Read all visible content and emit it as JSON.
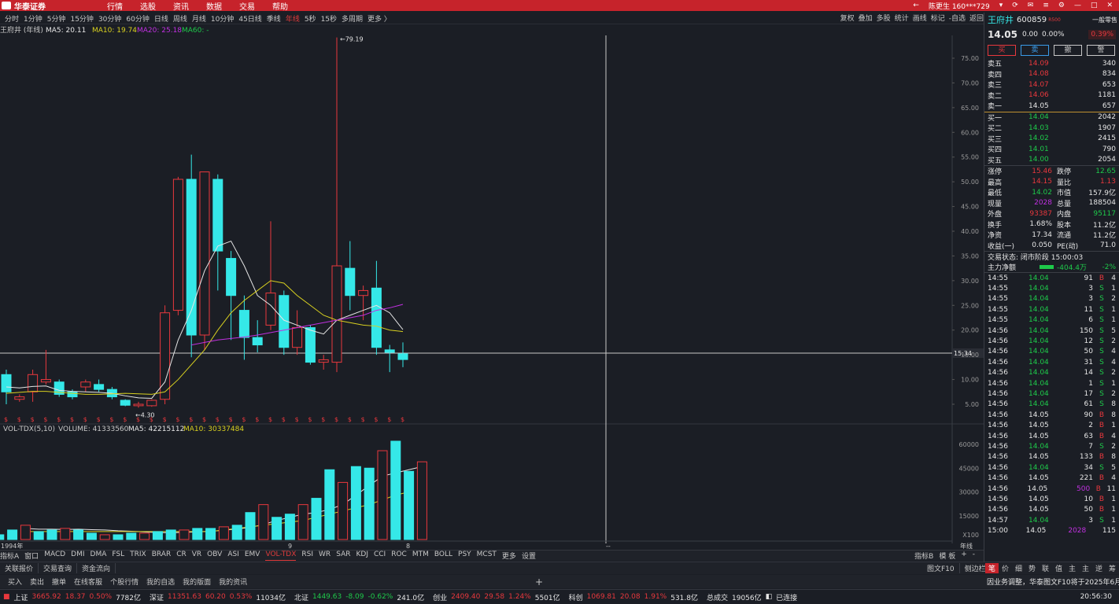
{
  "app": {
    "logo": "华泰证券",
    "menu": [
      "行情",
      "选股",
      "资讯",
      "数据",
      "交易",
      "帮助"
    ],
    "user": "陈更生 160***729"
  },
  "periods": [
    "分时",
    "1分钟",
    "5分钟",
    "15分钟",
    "30分钟",
    "60分钟",
    "日线",
    "周线",
    "月线",
    "10分钟",
    "45日线",
    "季线",
    "年线",
    "5秒",
    "15秒",
    "多周期",
    "更多 〉"
  ],
  "active_period": "年线",
  "tools": [
    "复权",
    "叠加",
    "多股",
    "统计",
    "画线",
    "标记",
    "-自选",
    "返回"
  ],
  "legend": {
    "name": "王府井 (年线)",
    "ma5": "MA5: 20.11",
    "ma10": "MA10: 19.74",
    "ma20": "MA20: 25.18",
    "ma60": "MA60: -"
  },
  "vol_legend": {
    "title": "VOL-TDX(5,10)",
    "volume": "VOLUME: 41333560",
    "ma5": "MA5: 42215112",
    "ma10": "MA10: 30337484"
  },
  "price_axis": [
    "75.00",
    "70.00",
    "65.00",
    "60.00",
    "55.00",
    "50.00",
    "45.00",
    "40.00",
    "35.00",
    "30.00",
    "25.00",
    "20.00",
    "15.00",
    "10.00",
    "5.00"
  ],
  "vol_axis": [
    "60000",
    "45000",
    "30000",
    "15000"
  ],
  "vol_unit": "X100",
  "crosshair_price": "15.34",
  "max_label": "79.19",
  "min_label": "4.30",
  "x_labels": {
    "start": "1994年",
    "mid": "9",
    "end": "8",
    "right": "年线",
    "dash": "--"
  },
  "colors": {
    "up": "#e8383d",
    "down": "#35e8e8",
    "ma5": "#e6e6e6",
    "ma10": "#d8d020",
    "ma20": "#c030e0"
  },
  "candles": [
    {
      "o": 11,
      "c": 7.5,
      "h": 12,
      "l": 5
    },
    {
      "o": 6,
      "c": 6.5,
      "h": 7,
      "l": 5.5
    },
    {
      "o": 7.5,
      "c": 11,
      "h": 12,
      "l": 5.5
    },
    {
      "o": 9.5,
      "c": 10,
      "h": 16,
      "l": 9
    },
    {
      "o": 9.5,
      "c": 7,
      "h": 10,
      "l": 6.5
    },
    {
      "o": 7.5,
      "c": 6.5,
      "h": 8,
      "l": 6
    },
    {
      "o": 8.5,
      "c": 9.5,
      "h": 10,
      "l": 7.5
    },
    {
      "o": 9,
      "c": 8,
      "h": 10,
      "l": 7.5
    },
    {
      "o": 8,
      "c": 6.5,
      "h": 8.5,
      "l": 6
    },
    {
      "o": 5.8,
      "c": 4.8,
      "h": 6,
      "l": 4.6
    },
    {
      "o": 4.7,
      "c": 5,
      "h": 5.5,
      "l": 4.3
    },
    {
      "o": 4.7,
      "c": 5.8,
      "h": 6,
      "l": 4.5
    },
    {
      "o": 6,
      "c": 23.5,
      "h": 25,
      "l": 5
    },
    {
      "o": 24,
      "c": 50.5,
      "h": 51,
      "l": 23
    },
    {
      "o": 50.5,
      "c": 19,
      "h": 55.5,
      "l": 14.5
    },
    {
      "o": 19,
      "c": 52,
      "h": 52,
      "l": 16
    },
    {
      "o": 50.5,
      "c": 36,
      "h": 51.5,
      "l": 28
    },
    {
      "o": 34.5,
      "c": 27,
      "h": 36,
      "l": 18
    },
    {
      "o": 24,
      "c": 18.5,
      "h": 27,
      "l": 14
    },
    {
      "o": 18.5,
      "c": 17,
      "h": 22,
      "l": 15.5
    },
    {
      "o": 21,
      "c": 27.5,
      "h": 42,
      "l": 20
    },
    {
      "o": 27,
      "c": 16.5,
      "h": 28,
      "l": 15
    },
    {
      "o": 16.5,
      "c": 20.5,
      "h": 24,
      "l": 15
    },
    {
      "o": 20.5,
      "c": 13.5,
      "h": 21,
      "l": 13
    },
    {
      "o": 13.5,
      "c": 14,
      "h": 15,
      "l": 12
    },
    {
      "o": 13.5,
      "c": 33,
      "h": 79.19,
      "l": 11.5
    },
    {
      "o": 32.5,
      "c": 27,
      "h": 38,
      "l": 24
    },
    {
      "o": 27,
      "c": 28,
      "h": 29,
      "l": 22
    },
    {
      "o": 28.5,
      "c": 16.5,
      "h": 34,
      "l": 15
    },
    {
      "o": 16,
      "c": 15.5,
      "h": 17,
      "l": 11.5
    },
    {
      "o": 15.2,
      "c": 14.05,
      "h": 17.5,
      "l": 12.5
    }
  ],
  "ma5_line": [
    8.5,
    8.3,
    8.6,
    8.7,
    7.8,
    7.6,
    7.5,
    7.4,
    7.2,
    6.7,
    6.3,
    6.2,
    9.5,
    18,
    24,
    32,
    37,
    38,
    33,
    27,
    25,
    22,
    21,
    20,
    19.2,
    22,
    23,
    24,
    25,
    23.5,
    20.1
  ],
  "ma10_line": [
    7.2,
    7.4,
    7.6,
    7.6,
    7.4,
    7.2,
    7,
    7,
    7.1,
    7.2,
    7.1,
    7,
    7.5,
    10,
    13,
    16,
    20,
    23.5,
    26,
    28,
    30,
    29.5,
    27,
    25,
    23,
    22,
    21.5,
    21,
    20.8,
    20,
    19.7
  ],
  "ma20_line": [
    17,
    17.5,
    18,
    18.3,
    18.6,
    19,
    19.5,
    20,
    20.5,
    21,
    21.5,
    22,
    22.5,
    23,
    24,
    24.5,
    25.2
  ],
  "volumes": [
    8,
    3,
    6,
    9,
    5,
    6,
    7,
    6,
    4,
    3,
    3,
    4,
    4,
    5,
    6,
    6,
    7,
    7,
    8,
    9,
    17,
    22,
    14,
    16,
    22,
    26,
    44,
    36,
    46,
    45,
    56,
    62,
    43,
    49
  ],
  "vol_ma5": [
    7,
    6.5,
    6.5,
    6.3,
    6.5,
    6.2,
    6,
    5.5,
    5.2,
    4.8,
    4.4,
    4.3,
    4.5,
    4.8,
    5.2,
    5.8,
    6.6,
    7.6,
    9.5,
    12,
    14,
    16,
    17,
    19,
    22,
    28,
    34,
    40,
    42,
    44,
    46
  ],
  "vol_ma10": [
    5,
    5,
    5,
    5,
    5,
    5,
    5,
    5,
    5,
    5,
    5,
    5,
    5,
    5,
    5,
    6,
    7,
    8,
    9,
    10,
    11,
    12,
    14,
    16,
    18,
    20,
    22,
    25,
    28,
    30
  ],
  "dividend_marks": [
    "$",
    "$",
    "$",
    "$",
    "$",
    "$",
    "$",
    "$",
    "$",
    "$",
    "$",
    "$",
    "$",
    "$",
    "$",
    "$",
    "$",
    "$",
    "$",
    "$",
    "$",
    "$",
    "$",
    "$",
    "$",
    "$",
    "$",
    "$",
    "$",
    "$",
    "$"
  ],
  "quote": {
    "name": "王府井",
    "code": "600859",
    "tag": "R500",
    "mode": "一般零售",
    "price": "14.05",
    "change": "0.00",
    "pct": "0.00%",
    "sector_pct": "0.39%",
    "buttons": [
      "买",
      "卖",
      "撤",
      "警"
    ],
    "asks": [
      {
        "l": "卖五",
        "p": "14.09",
        "v": "340"
      },
      {
        "l": "卖四",
        "p": "14.08",
        "v": "834"
      },
      {
        "l": "卖三",
        "p": "14.07",
        "v": "653"
      },
      {
        "l": "卖二",
        "p": "14.06",
        "v": "1181"
      },
      {
        "l": "卖一",
        "p": "14.05",
        "v": "657"
      }
    ],
    "bids": [
      {
        "l": "买一",
        "p": "14.04",
        "v": "2042"
      },
      {
        "l": "买二",
        "p": "14.03",
        "v": "1907"
      },
      {
        "l": "买三",
        "p": "14.02",
        "v": "2415"
      },
      {
        "l": "买四",
        "p": "14.01",
        "v": "790"
      },
      {
        "l": "买五",
        "p": "14.00",
        "v": "2054"
      }
    ],
    "stats": [
      [
        "涨停",
        "15.46",
        "跌停",
        "12.65"
      ],
      [
        "最高",
        "14.15",
        "量比",
        "1.13"
      ],
      [
        "最低",
        "14.02",
        "市值",
        "157.9亿"
      ],
      [
        "现量",
        "2028",
        "总量",
        "188504"
      ],
      [
        "外盘",
        "93387",
        "内盘",
        "95117"
      ],
      [
        "换手",
        "1.68%",
        "股本",
        "11.2亿"
      ],
      [
        "净资",
        "17.34",
        "流通",
        "11.2亿"
      ],
      [
        "收益(一)",
        "0.050",
        "PE(动)",
        "71.0"
      ]
    ],
    "trade_state": "交易状态: 闭市阶段 15:00:03",
    "main_flow_label": "主力净额",
    "main_flow": "-404.4万",
    "main_flow_pct": "-2%"
  },
  "ticks": [
    [
      "14:55",
      "14.04",
      "91",
      "B",
      "4"
    ],
    [
      "14:55",
      "14.04",
      "3",
      "S",
      "1"
    ],
    [
      "14:55",
      "14.04",
      "3",
      "S",
      "2"
    ],
    [
      "14:55",
      "14.04",
      "11",
      "S",
      "1"
    ],
    [
      "14:55",
      "14.04",
      "6",
      "S",
      "1"
    ],
    [
      "14:56",
      "14.04",
      "150",
      "S",
      "5"
    ],
    [
      "14:56",
      "14.04",
      "12",
      "S",
      "2"
    ],
    [
      "14:56",
      "14.04",
      "50",
      "S",
      "4"
    ],
    [
      "14:56",
      "14.04",
      "31",
      "S",
      "4"
    ],
    [
      "14:56",
      "14.04",
      "14",
      "S",
      "2"
    ],
    [
      "14:56",
      "14.04",
      "1",
      "S",
      "1"
    ],
    [
      "14:56",
      "14.04",
      "17",
      "S",
      "2"
    ],
    [
      "14:56",
      "14.04",
      "61",
      "S",
      "8"
    ],
    [
      "14:56",
      "14.05",
      "90",
      "B",
      "8"
    ],
    [
      "14:56",
      "14.05",
      "2",
      "B",
      "1"
    ],
    [
      "14:56",
      "14.05",
      "63",
      "B",
      "4"
    ],
    [
      "14:56",
      "14.04",
      "7",
      "S",
      "2"
    ],
    [
      "14:56",
      "14.05",
      "133",
      "B",
      "8"
    ],
    [
      "14:56",
      "14.04",
      "34",
      "S",
      "5"
    ],
    [
      "14:56",
      "14.05",
      "221",
      "B",
      "4"
    ],
    [
      "14:56",
      "14.05",
      "500",
      "B",
      "11"
    ],
    [
      "14:56",
      "14.05",
      "10",
      "B",
      "1"
    ],
    [
      "14:56",
      "14.05",
      "50",
      "B",
      "1"
    ],
    [
      "14:57",
      "14.04",
      "3",
      "S",
      "1"
    ],
    [
      "15:00",
      "14.05",
      "2028",
      "",
      "115"
    ]
  ],
  "indicators": [
    "指标A",
    "窗口",
    "MACD",
    "DMI",
    "DMA",
    "FSL",
    "TRIX",
    "BRAR",
    "CR",
    "VR",
    "OBV",
    "ASI",
    "EMV",
    "VOL-TDX",
    "RSI",
    "WR",
    "SAR",
    "KDJ",
    "CCI",
    "ROC",
    "MTM",
    "BOLL",
    "PSY",
    "MCST",
    "更多",
    "设置"
  ],
  "active_indicator": "VOL-TDX",
  "ind_right": [
    "指标B",
    "模 板",
    "+",
    "-"
  ],
  "tabs": [
    "关联报价",
    "交易查询",
    "资金流向"
  ],
  "tab_right": [
    "图文F10",
    "侧边栏"
  ],
  "rp_tabs": [
    "笔",
    "价",
    "细",
    "势",
    "联",
    "值",
    "主",
    "主",
    "逆",
    "筹"
  ],
  "actions": [
    "买入",
    "卖出",
    "撤单",
    "在线客服",
    "个股行情",
    "我的自选",
    "我的版面",
    "我的资讯",
    "+"
  ],
  "news": "因业务调整，华泰图文F10将于2025年6月",
  "status": {
    "sh": "上证",
    "sh_v": "3665.92",
    "sh_c": "18.37",
    "sh_p": "0.50%",
    "sh_a": "7782亿",
    "sz": "深证",
    "sz_v": "11351.63",
    "sz_c": "60.20",
    "sz_p": "0.53%",
    "sz_a": "11034亿",
    "bz": "北证",
    "bz_v": "1449.63",
    "bz_c": "-8.09",
    "bz_p": "-0.62%",
    "bz_a": "241.0亿",
    "cy": "创业",
    "cy_v": "2409.40",
    "cy_c": "29.58",
    "cy_p": "1.24%",
    "cy_a": "5501亿",
    "kc": "科创",
    "kc_v": "1069.81",
    "kc_c": "20.08",
    "kc_p": "1.91%",
    "kc_a": "531.8亿",
    "total_l": "总成交",
    "total": "19056亿",
    "conn": "已连接",
    "time": "20:56:30"
  }
}
